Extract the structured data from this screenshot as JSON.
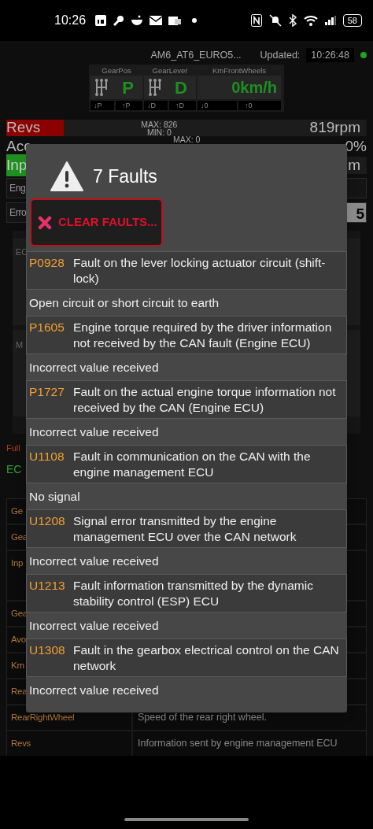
{
  "status_bar": {
    "time": "10:26",
    "battery": "58"
  },
  "header": {
    "profile": "AM6_AT6_EURO5...",
    "updated_label": "Updated:",
    "updated_time": "10:26:48",
    "connected": true
  },
  "gear_panel": [
    {
      "kind": "gear",
      "label": "GearPos",
      "value": "P",
      "low": "↓P",
      "high": "↑P"
    },
    {
      "kind": "gear",
      "label": "GearLever",
      "value": "D",
      "low": "↓D",
      "high": "↑D"
    },
    {
      "kind": "speed",
      "label": "KmFrontWheels",
      "value": "0km/h",
      "low": "↓0",
      "high": "↑0"
    }
  ],
  "revs": {
    "label": "Revs",
    "max": "MAX: 826",
    "min": "MIN: 0",
    "reading": "819rpm",
    "level": 0.16
  },
  "background_rows": [
    {
      "kind": "gauge",
      "label": "Acc",
      "reading": "0%",
      "caption": "MAX: 0"
    },
    {
      "kind": "green",
      "label": "Inp",
      "reading": "m"
    },
    {
      "kind": "field",
      "label": "Eng"
    },
    {
      "kind": "field",
      "label": "Erro",
      "value": "5"
    }
  ],
  "panels": [
    {
      "label": "EC"
    },
    {
      "label": "M"
    }
  ],
  "notes": [
    {
      "kind": "warning",
      "text": "Full"
    },
    {
      "kind": "ok",
      "text": "EC"
    }
  ],
  "table_rows": [
    {
      "name": "Ge"
    },
    {
      "name": "Gea"
    },
    {
      "name": "Inp"
    },
    {
      "name": "Gea"
    },
    {
      "name": "Avo"
    },
    {
      "name": "Km"
    },
    {
      "name": "Rea"
    },
    {
      "name": "RearRightWheel",
      "description": "Speed of the rear right wheel."
    },
    {
      "name": "Revs",
      "description": "Information sent by engine management ECU"
    }
  ],
  "dialog": {
    "title": "7 Faults",
    "clear_button": "CLEAR FAULTS...",
    "faults": [
      {
        "code": "P0928",
        "text": "Fault on the lever locking actuator circuit (shift-lock)",
        "detail": "Open circuit or short circuit to earth"
      },
      {
        "code": "P1605",
        "text": "Engine torque required by the driver information not received by the CAN fault (Engine ECU)",
        "detail": "Incorrect value received"
      },
      {
        "code": "P1727",
        "text": "Fault on the actual engine torque information not received by the CAN (Engine ECU)",
        "detail": "Incorrect value received"
      },
      {
        "code": "U1108",
        "text": "Fault in communication on the CAN with the engine management ECU",
        "detail": "No signal"
      },
      {
        "code": "U1208",
        "text": "Signal error transmitted by the engine management ECU over the CAN network",
        "detail": "Incorrect value received"
      },
      {
        "code": "U1213",
        "text": "Fault information transmitted by the dynamic stability control (ESP) ECU",
        "detail": "Incorrect value received"
      },
      {
        "code": "U1308",
        "text": "Fault in the gearbox electrical control on the CAN network",
        "detail": "Incorrect value received"
      }
    ]
  }
}
